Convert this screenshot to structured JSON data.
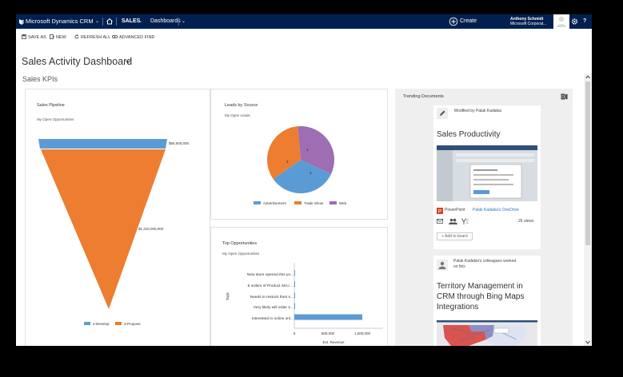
{
  "nav": {
    "app_name": "Microsoft Dynamics CRM",
    "area": "SALES",
    "subarea": "Dashboards",
    "create": "Create",
    "user_name": "Anthony Schmidt",
    "org_name": "Microsoft Corporat...",
    "help": "?"
  },
  "commands": {
    "save_as": "SAVE AS",
    "new": "NEW",
    "refresh_all": "REFRESH ALL",
    "advanced_find": "ADVANCED FIND"
  },
  "page": {
    "title": "Sales Activity Dashboard",
    "section": "Sales KPIs"
  },
  "pipeline": {
    "title": "Sales Pipeline",
    "subtitle": "My Open Opportunities",
    "stage_labels": [
      "$55,000,000",
      "$1,310,000,000"
    ],
    "legend": [
      "2-Develop",
      "3-Propose"
    ]
  },
  "leads": {
    "title": "Leads by Source",
    "subtitle": "My Open Leads",
    "slice_labels": [
      "3",
      "3",
      "3"
    ],
    "legend": [
      "Advertisement",
      "Trade Show",
      "Web"
    ]
  },
  "top_opps": {
    "title": "Top Opportunities",
    "subtitle": "My Open Opportunities",
    "y_axis_label": "Topic",
    "x_axis_label": "Est. Revenue",
    "categories": [
      "New store opened this ye...",
      "6 orders of Product SKU ...",
      "Needs to restock their s...",
      "Very likely will order 1...",
      "Interested in online onl..."
    ],
    "x_ticks": [
      "0",
      "500,000",
      "1,000,000"
    ]
  },
  "trending": {
    "title": "Trending Documents",
    "card1": {
      "modified_by": "Modified by Palak Kadakia",
      "doc_title": "Sales Productivity",
      "app": "PowerPoint",
      "location": "Palak Kadakia's OneDrive",
      "views": "26 views",
      "add_to_board": "+ Add to board"
    },
    "card2": {
      "byline_1": "Palak Kadakia's colleagues worked",
      "byline_2": "on this",
      "doc_title_1": "Territory Management in",
      "doc_title_2": "CRM through Bing Maps",
      "doc_title_3": "Integrations"
    }
  },
  "colors": {
    "nav_bg": "#002050",
    "blue": "#5b9bd5",
    "orange": "#ed7d31",
    "purple": "#9e6db2",
    "link": "#2e75b6"
  },
  "chart_data": [
    {
      "type": "funnel",
      "title": "Sales Pipeline",
      "subtitle": "My Open Opportunities",
      "categories": [
        "2-Develop",
        "3-Propose"
      ],
      "values": [
        55000000,
        1310000000
      ]
    },
    {
      "type": "pie",
      "title": "Leads by Source",
      "subtitle": "My Open Leads",
      "categories": [
        "Advertisement",
        "Trade Show",
        "Web"
      ],
      "values": [
        3,
        3,
        3
      ]
    },
    {
      "type": "bar",
      "orientation": "horizontal",
      "title": "Top Opportunities",
      "subtitle": "My Open Opportunities",
      "categories": [
        "New store opened this ye...",
        "6 orders of Product SKU ...",
        "Needs to restock their s...",
        "Very likely will order 1...",
        "Interested in online onl..."
      ],
      "values": [
        5000,
        8000,
        10000,
        12000,
        1000000
      ],
      "xlabel": "Est. Revenue",
      "ylabel": "Topic",
      "xlim": [
        0,
        1200000
      ],
      "x_ticks": [
        0,
        500000,
        1000000
      ]
    }
  ]
}
